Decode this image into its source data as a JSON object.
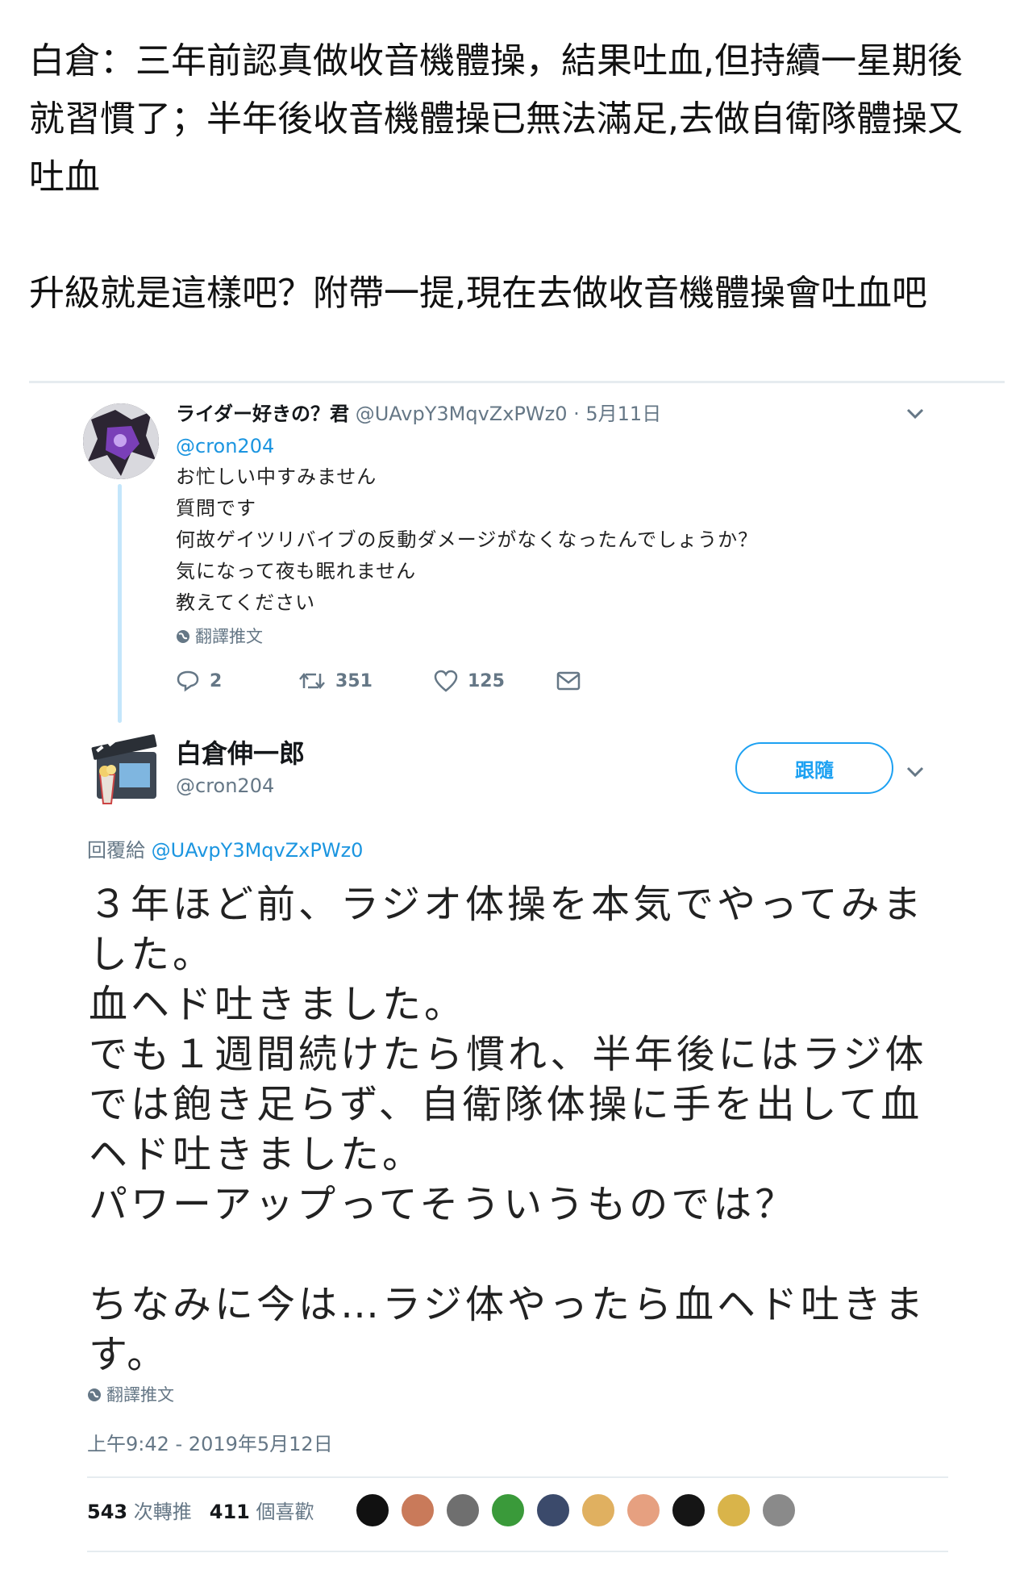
{
  "caption": {
    "line1": "白倉：三年前認真做收音機體操，結果吐血,但持續一星期後",
    "line2": "就習慣了；半年後收音機體操已無法滿足,去做自衛隊體操又",
    "line3": "吐血",
    "line4": "升級就是這樣吧？附帶一提,現在去做收音機體操會吐血吧"
  },
  "reply_tweet": {
    "display_name": "ライダー好きの？君",
    "handle": "@UAvpY3MqvZxPWz0",
    "date": "· 5月11日",
    "mention": "@cron204",
    "lines": [
      "お忙しい中すみません",
      "質問です",
      "何故ゲイツリバイブの反動ダメージがなくなったんでしょうか？",
      "気になって夜も眠れません",
      "教えてください"
    ],
    "translate_label": "翻譯推文",
    "reply_count": "2",
    "retweet_count": "351",
    "like_count": "125"
  },
  "main_tweet": {
    "display_name": "白倉伸一郎",
    "handle": "@cron204",
    "follow_label": "跟隨",
    "reply_prefix": "回覆給",
    "reply_to": "@UAvpY3MqvZxPWz0",
    "lines": [
      "３年ほど前、ラジオ体操を本気でやってみま",
      "した。",
      "血ヘド吐きました。",
      "でも１週間続けたら慣れ、半年後にはラジ体",
      "では飽き足らず、自衛隊体操に手を出して血",
      "ヘド吐きました。",
      "パワーアップってそういうものでは？",
      "",
      "ちなみに今は…ラジ体やったら血ヘド吐きま",
      "す。"
    ],
    "translate_label": "翻譯推文",
    "timestamp": "上午9:42 - 2019年5月12日",
    "retweets": "543",
    "retweets_label": "次轉推",
    "likes": "411",
    "likes_label": "個喜歡"
  },
  "colors": {
    "accent": "#1da1f2",
    "link": "#1b95e0",
    "muted": "#657786",
    "thread_line": "#c4e6fb"
  },
  "liker_avatar_colors": [
    "#111111",
    "#c97a5a",
    "#6f6f6f",
    "#3a9a3a",
    "#3b4a6b",
    "#e0b060",
    "#e6a080",
    "#151515",
    "#d9b44a",
    "#8a8a8a"
  ]
}
